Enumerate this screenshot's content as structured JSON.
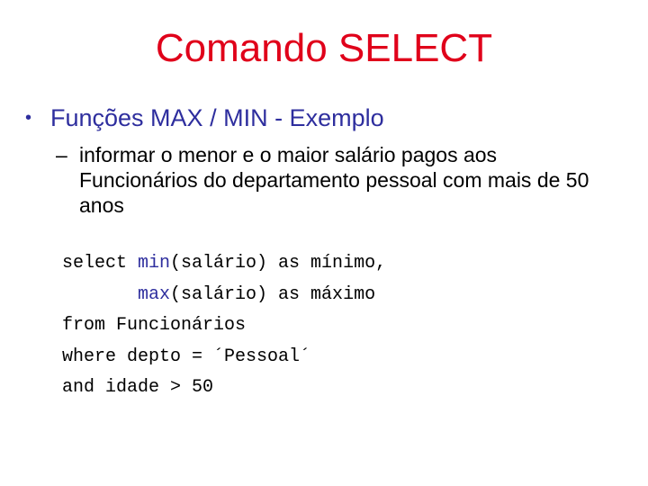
{
  "slide": {
    "title": "Comando SELECT",
    "bullet_marker": "•",
    "bullet": "Funções MAX / MIN - Exemplo",
    "sub_marker": "–",
    "sub_text": "informar o menor e o maior salário pagos aos Funcionários do departamento pessoal com mais de 50 anos",
    "colors": {
      "title": "#e0001a",
      "bullet": "#2e2e9e",
      "keyword_fn": "#2e2e9e"
    }
  },
  "code": {
    "line1": {
      "pre": "select ",
      "fn": "min",
      "post": "(salário) as mínimo,"
    },
    "line2": {
      "pre": "       ",
      "fn": "max",
      "post": "(salário) as máximo"
    },
    "line3": "from Funcionários",
    "line4": "where depto = ´Pessoal´",
    "line5": "and idade > 50"
  }
}
